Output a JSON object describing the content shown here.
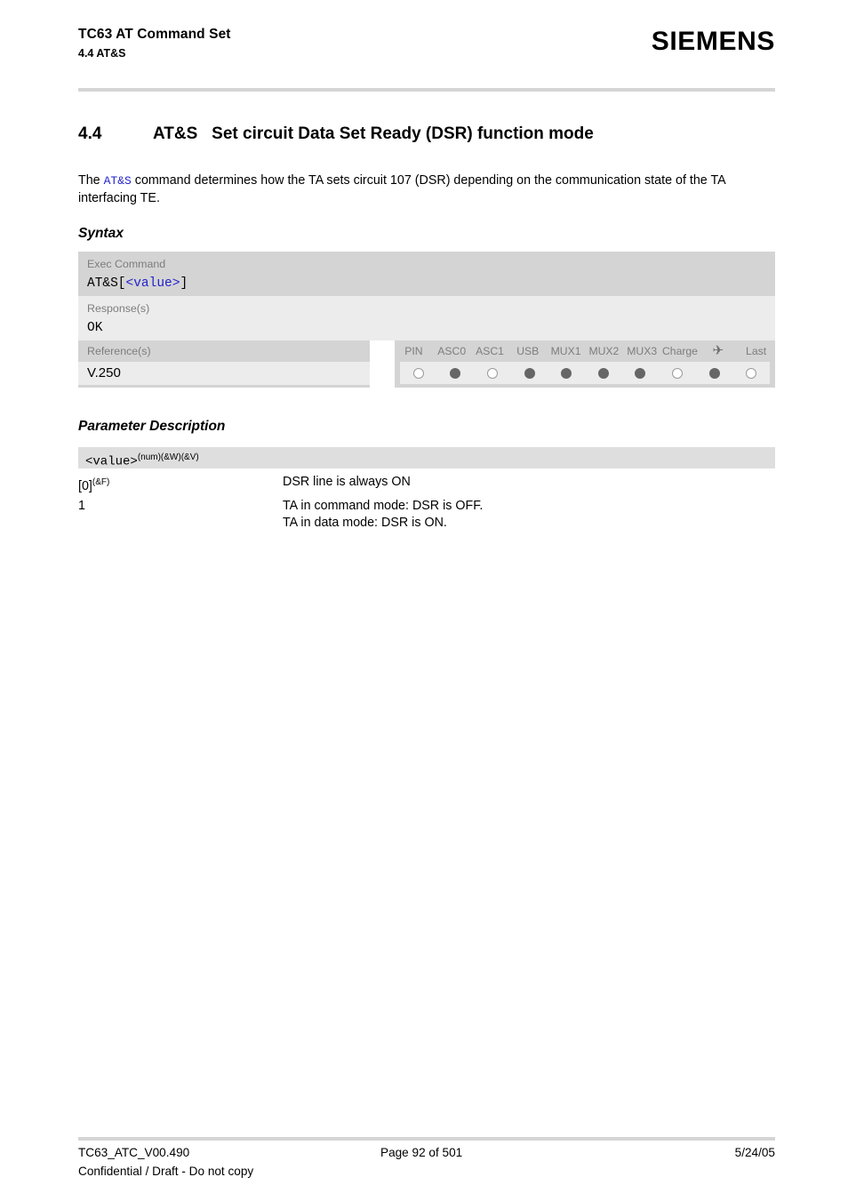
{
  "header": {
    "title": "TC63 AT Command Set",
    "subtitle": "4.4 AT&S",
    "brand": "SIEMENS"
  },
  "section": {
    "number": "4.4",
    "command": "AT&S",
    "title": "Set circuit Data Set Ready (DSR) function mode"
  },
  "intro": {
    "before": "The ",
    "command_link": "AT&S",
    "after": " command determines how the TA sets circuit 107 (DSR) depending on the communication state of the TA interfacing TE."
  },
  "syntax": {
    "heading": "Syntax",
    "exec_label": "Exec Command",
    "exec_prefix": "AT&S[",
    "exec_placeholder": "<value>",
    "exec_suffix": "]",
    "response_label": "Response(s)",
    "response_value": "OK",
    "reference_label": "Reference(s)",
    "reference_value": "V.250"
  },
  "support_matrix": {
    "columns": [
      {
        "label": "PIN",
        "icon": "",
        "supported": false
      },
      {
        "label": "ASC0",
        "icon": "",
        "supported": true
      },
      {
        "label": "ASC1",
        "icon": "",
        "supported": false
      },
      {
        "label": "USB",
        "icon": "",
        "supported": true
      },
      {
        "label": "MUX1",
        "icon": "",
        "supported": true
      },
      {
        "label": "MUX2",
        "icon": "",
        "supported": true
      },
      {
        "label": "MUX3",
        "icon": "",
        "supported": true
      },
      {
        "label": "Charge",
        "icon": "",
        "supported": false
      },
      {
        "label": "✈",
        "icon": "airplane-icon",
        "supported": true
      },
      {
        "label": "Last",
        "icon": "",
        "supported": false
      }
    ]
  },
  "parameter_description": {
    "heading": "Parameter Description",
    "name": "<value>",
    "name_superscript": "(num)(&W)(&V)",
    "rows": [
      {
        "key": "[0]",
        "key_superscript": "(&F)",
        "desc": "DSR line is always ON"
      },
      {
        "key": "1",
        "key_superscript": "",
        "desc": "TA in command mode: DSR is OFF.\nTA in data mode: DSR is ON."
      }
    ]
  },
  "footer": {
    "doc_id": "TC63_ATC_V00.490",
    "page": "Page 92 of 501",
    "date": "5/24/05",
    "confidential": "Confidential / Draft - Do not copy"
  },
  "colors": {
    "band_dark": "#d4d4d4",
    "band_light": "#ececec",
    "band_param": "#dedede",
    "rule": "#d5d5d5",
    "label_gray": "#7d7d7d",
    "link_blue": "#2222cc",
    "dot_on": "#666666"
  }
}
